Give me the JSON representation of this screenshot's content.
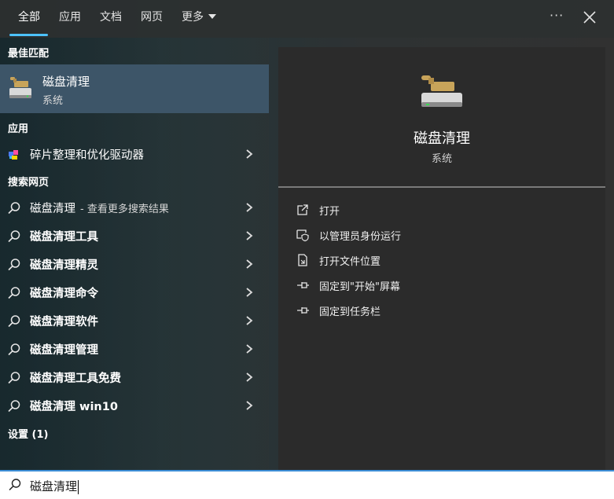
{
  "tabs": [
    {
      "label": "全部"
    },
    {
      "label": "应用"
    },
    {
      "label": "文档"
    },
    {
      "label": "网页"
    },
    {
      "label": "更多"
    }
  ],
  "window": {
    "more_options": "···"
  },
  "best_match": {
    "section_title": "最佳匹配",
    "title": "磁盘清理",
    "subtitle": "系统",
    "icon": "disk-cleanup-icon"
  },
  "apps": {
    "section_title": "应用",
    "items": [
      {
        "label": "碎片整理和优化驱动器",
        "icon": "defrag-icon"
      }
    ]
  },
  "web": {
    "section_title": "搜索网页",
    "items": [
      {
        "label": "磁盘清理",
        "suffix": "- 查看更多搜索结果"
      },
      {
        "label": "磁盘清理工具"
      },
      {
        "label": "磁盘清理精灵"
      },
      {
        "label": "磁盘清理命令"
      },
      {
        "label": "磁盘清理软件"
      },
      {
        "label": "磁盘清理管理"
      },
      {
        "label": "磁盘清理工具免费"
      },
      {
        "label": "磁盘清理 win10"
      }
    ]
  },
  "settings": {
    "section_title": "设置 (1)"
  },
  "preview": {
    "title": "磁盘清理",
    "subtitle": "系统",
    "actions": [
      {
        "label": "打开",
        "icon": "open-icon"
      },
      {
        "label": "以管理员身份运行",
        "icon": "run-as-admin-icon"
      },
      {
        "label": "打开文件位置",
        "icon": "file-location-icon"
      },
      {
        "label": "固定到\"开始\"屏幕",
        "icon": "pin-icon"
      },
      {
        "label": "固定到任务栏",
        "icon": "pin-icon"
      }
    ]
  },
  "search": {
    "value": "磁盘清理"
  },
  "colors": {
    "accent": "#4cc2ff",
    "selected_row": "#3d5568"
  }
}
